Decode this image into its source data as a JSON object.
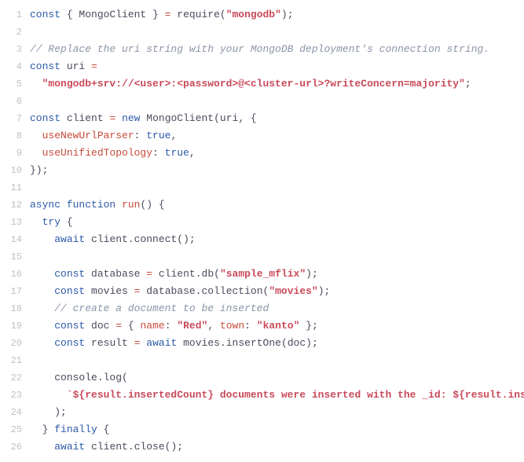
{
  "code": {
    "tokens": [
      [
        [
          "kw",
          "const"
        ],
        [
          "punc",
          " { "
        ],
        [
          "id",
          "MongoClient"
        ],
        [
          "punc",
          " } "
        ],
        [
          "op",
          "="
        ],
        [
          "punc",
          " "
        ],
        [
          "req",
          "require"
        ],
        [
          "punc",
          "("
        ],
        [
          "str",
          "\"mongodb\""
        ],
        [
          "punc",
          ");"
        ]
      ],
      [],
      [
        [
          "cmt",
          "// Replace the uri string with your MongoDB deployment's connection string."
        ]
      ],
      [
        [
          "kw",
          "const"
        ],
        [
          "punc",
          " "
        ],
        [
          "id",
          "uri"
        ],
        [
          "punc",
          " "
        ],
        [
          "op",
          "="
        ]
      ],
      [
        [
          "punc",
          "  "
        ],
        [
          "str",
          "\"mongodb+srv://<user>:<password>@<cluster-url>?writeConcern=majority\""
        ],
        [
          "punc",
          ";"
        ]
      ],
      [],
      [
        [
          "kw",
          "const"
        ],
        [
          "punc",
          " "
        ],
        [
          "id",
          "client"
        ],
        [
          "punc",
          " "
        ],
        [
          "op",
          "="
        ],
        [
          "punc",
          " "
        ],
        [
          "kw",
          "new"
        ],
        [
          "punc",
          " "
        ],
        [
          "id",
          "MongoClient"
        ],
        [
          "punc",
          "(uri, {"
        ]
      ],
      [
        [
          "punc",
          "  "
        ],
        [
          "red",
          "useNewUrlParser"
        ],
        [
          "punc",
          ": "
        ],
        [
          "bool",
          "true"
        ],
        [
          "punc",
          ","
        ]
      ],
      [
        [
          "punc",
          "  "
        ],
        [
          "red",
          "useUnifiedTopology"
        ],
        [
          "punc",
          ": "
        ],
        [
          "bool",
          "true"
        ],
        [
          "punc",
          ","
        ]
      ],
      [
        [
          "punc",
          "});"
        ]
      ],
      [],
      [
        [
          "kw",
          "async"
        ],
        [
          "punc",
          " "
        ],
        [
          "kw",
          "function"
        ],
        [
          "punc",
          " "
        ],
        [
          "red",
          "run"
        ],
        [
          "punc",
          "() {"
        ]
      ],
      [
        [
          "punc",
          "  "
        ],
        [
          "kw",
          "try"
        ],
        [
          "punc",
          " {"
        ]
      ],
      [
        [
          "punc",
          "    "
        ],
        [
          "kw",
          "await"
        ],
        [
          "punc",
          " client."
        ],
        [
          "fn",
          "connect"
        ],
        [
          "punc",
          "();"
        ]
      ],
      [],
      [
        [
          "punc",
          "    "
        ],
        [
          "kw",
          "const"
        ],
        [
          "punc",
          " "
        ],
        [
          "id",
          "database"
        ],
        [
          "punc",
          " "
        ],
        [
          "op",
          "="
        ],
        [
          "punc",
          " client."
        ],
        [
          "fn",
          "db"
        ],
        [
          "punc",
          "("
        ],
        [
          "str",
          "\"sample_mflix\""
        ],
        [
          "punc",
          ");"
        ]
      ],
      [
        [
          "punc",
          "    "
        ],
        [
          "kw",
          "const"
        ],
        [
          "punc",
          " "
        ],
        [
          "id",
          "movies"
        ],
        [
          "punc",
          " "
        ],
        [
          "op",
          "="
        ],
        [
          "punc",
          " database."
        ],
        [
          "fn",
          "collection"
        ],
        [
          "punc",
          "("
        ],
        [
          "str",
          "\"movies\""
        ],
        [
          "punc",
          ");"
        ]
      ],
      [
        [
          "punc",
          "    "
        ],
        [
          "cmt",
          "// create a document to be inserted"
        ]
      ],
      [
        [
          "punc",
          "    "
        ],
        [
          "kw",
          "const"
        ],
        [
          "punc",
          " "
        ],
        [
          "id",
          "doc"
        ],
        [
          "punc",
          " "
        ],
        [
          "op",
          "="
        ],
        [
          "punc",
          " { "
        ],
        [
          "red",
          "name"
        ],
        [
          "punc",
          ": "
        ],
        [
          "str",
          "\"Red\""
        ],
        [
          "punc",
          ", "
        ],
        [
          "red",
          "town"
        ],
        [
          "punc",
          ": "
        ],
        [
          "str",
          "\"kanto\""
        ],
        [
          "punc",
          " };"
        ]
      ],
      [
        [
          "punc",
          "    "
        ],
        [
          "kw",
          "const"
        ],
        [
          "punc",
          " "
        ],
        [
          "id",
          "result"
        ],
        [
          "punc",
          " "
        ],
        [
          "op",
          "="
        ],
        [
          "punc",
          " "
        ],
        [
          "kw",
          "await"
        ],
        [
          "punc",
          " movies."
        ],
        [
          "fn",
          "insertOne"
        ],
        [
          "punc",
          "(doc);"
        ]
      ],
      [],
      [
        [
          "punc",
          "    console."
        ],
        [
          "fn",
          "log"
        ],
        [
          "punc",
          "("
        ]
      ],
      [
        [
          "punc",
          "      "
        ],
        [
          "str",
          "`${result.insertedCount} documents were inserted with the _id: ${result.insertedId}"
        ]
      ],
      [
        [
          "punc",
          "    );"
        ]
      ],
      [
        [
          "punc",
          "  } "
        ],
        [
          "kw",
          "finally"
        ],
        [
          "punc",
          " {"
        ]
      ],
      [
        [
          "punc",
          "    "
        ],
        [
          "kw",
          "await"
        ],
        [
          "punc",
          " client."
        ],
        [
          "fn",
          "close"
        ],
        [
          "punc",
          "();"
        ]
      ]
    ],
    "lineStart": 1
  }
}
